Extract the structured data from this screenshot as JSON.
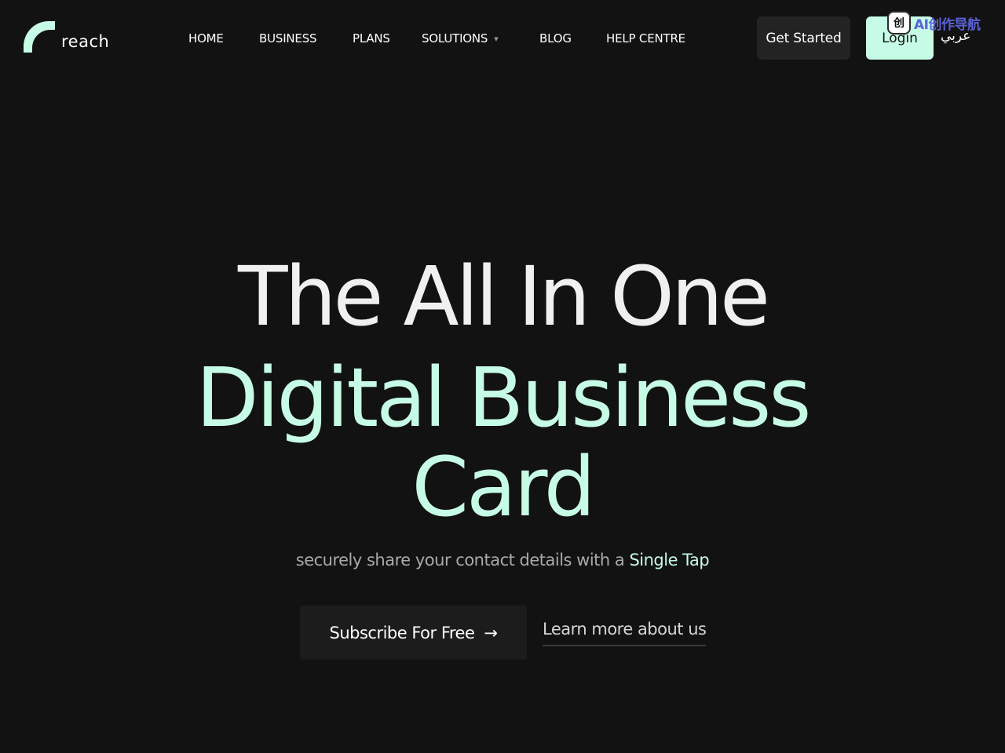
{
  "brand": {
    "name": "reach",
    "accent_color": "#c6fbe5",
    "background_color": "#121212"
  },
  "nav": {
    "items": [
      {
        "label": "HOME"
      },
      {
        "label": "BUSINESS"
      },
      {
        "label": "PLANS"
      },
      {
        "label": "SOLUTIONS",
        "has_dropdown": true
      },
      {
        "label": "BLOG"
      },
      {
        "label": "HELP CENTRE"
      }
    ]
  },
  "header": {
    "get_started_label": "Get Started",
    "login_label": "Login",
    "language_label": "عربي"
  },
  "extension_badge": {
    "icon_char": "创",
    "text": "AI创作导航"
  },
  "hero": {
    "line1": "The All In One",
    "line2": "Digital Business",
    "line3": "Card",
    "subtitle_prefix": "securely share your contact details with a ",
    "subtitle_highlight": "Single Tap",
    "subscribe_label": "Subscribe For Free",
    "subscribe_arrow": "→",
    "learn_more_label": "Learn more about us"
  }
}
